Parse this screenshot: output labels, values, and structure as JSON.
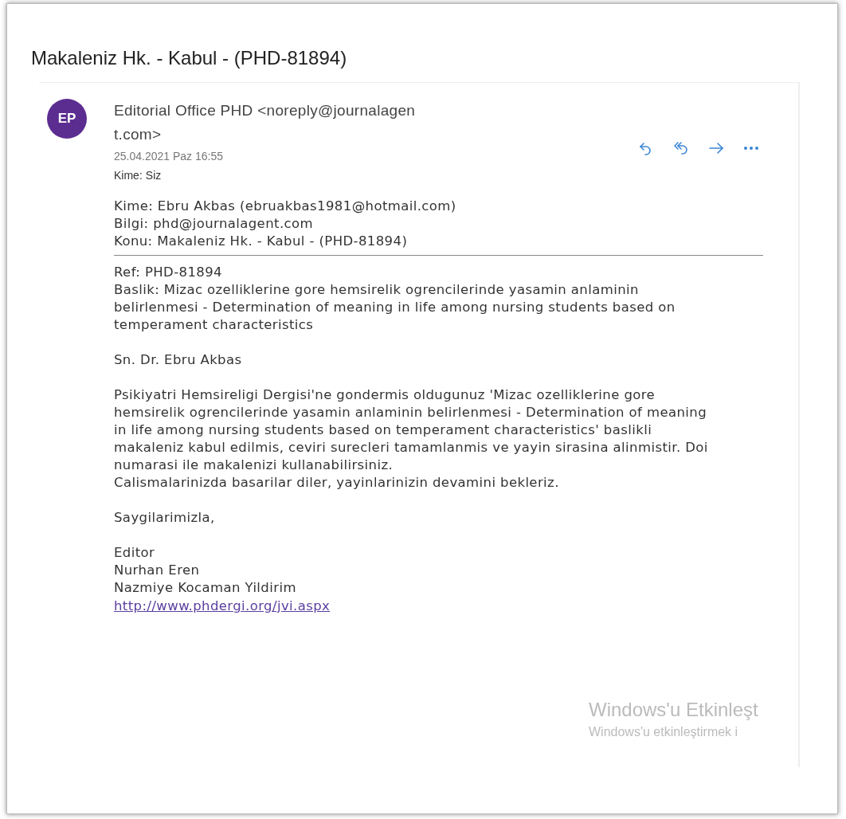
{
  "subject": "Makaleniz Hk. - Kabul - (PHD-81894)",
  "sender": {
    "initials": "EP",
    "name_lines": [
      "Editorial Office PHD <noreply@journalagen",
      "t.com>"
    ],
    "date": "25.04.2021 Paz 16:55",
    "to_label": "Kime:",
    "to_value": "Siz"
  },
  "actions": [
    {
      "kind": "reply"
    },
    {
      "kind": "reply_all"
    },
    {
      "kind": "forward"
    },
    {
      "kind": "more"
    }
  ],
  "header_lines": [
    "Kime: Ebru Akbas (ebruakbas1981@hotmail.com)",
    "Bilgi: phd@journalagent.com",
    "Konu: Makaleniz Hk. - Kabul - (PHD-81894)"
  ],
  "body": [
    {
      "lines": [
        "Ref: PHD-81894",
        "Baslik: Mizac ozelliklerine gore hemsirelik ogrencilerinde yasamin anlaminin",
        "belirlenmesi - Determination of meaning in life among nursing students based on",
        "temperament characteristics"
      ]
    },
    {
      "lines": [
        "Sn. Dr. Ebru Akbas"
      ]
    },
    {
      "lines": [
        "Psikiyatri Hemsireligi Dergisi'ne gondermis oldugunuz 'Mizac ozelliklerine gore",
        "hemsirelik ogrencilerinde yasamin anlaminin belirlenmesi - Determination of meaning",
        "in life among nursing students based on temperament characteristics' baslikli",
        "makaleniz kabul edilmis, ceviri surecleri tamamlanmis ve yayin sirasina alinmistir. Doi",
        "numarasi ile makalenizi kullanabilirsiniz.",
        "Calismalarinizda basarilar diler, yayinlarinizin devamini bekleriz."
      ]
    },
    {
      "lines": [
        "Saygilarimizla,"
      ]
    }
  ],
  "signature": [
    "Editor",
    "Nurhan Eren",
    "Nazmiye Kocaman Yildirim"
  ],
  "link": "http://www.phdergi.org/jvi.aspx",
  "activation": {
    "title": "Windows'u Etkinleşt",
    "subtitle": "Windows'u etkinleştirmek i"
  }
}
